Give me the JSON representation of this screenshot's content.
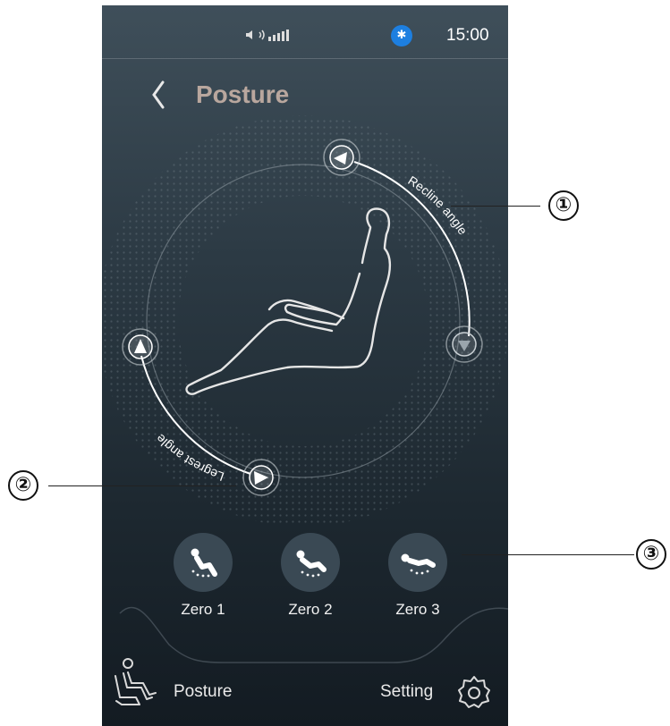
{
  "status_bar": {
    "time": "15:00",
    "bluetooth_icon": "bluetooth-icon",
    "sound_icon": "speaker-icon",
    "signal_icon": "signal-bars-icon"
  },
  "header": {
    "back_icon": "chevron-left-icon",
    "title": "Posture"
  },
  "posture_control": {
    "recline_label": "Recline angle",
    "legrest_label": "Legrest angle",
    "figure_icon": "reclined-person-icon"
  },
  "presets": [
    {
      "label": "Zero 1",
      "icon": "zero-gravity-1-icon"
    },
    {
      "label": "Zero 2",
      "icon": "zero-gravity-2-icon"
    },
    {
      "label": "Zero 3",
      "icon": "zero-gravity-3-icon"
    }
  ],
  "bottom_nav": {
    "posture_label": "Posture",
    "posture_icon": "chair-person-icon",
    "setting_label": "Setting",
    "setting_icon": "gear-icon"
  },
  "callouts": [
    "①",
    "②",
    "③"
  ],
  "colors": {
    "accent_blue": "#1d7fe0",
    "title": "#b9a79e",
    "bg_top": "#3f4f5a",
    "bg_bottom": "#131b22"
  }
}
